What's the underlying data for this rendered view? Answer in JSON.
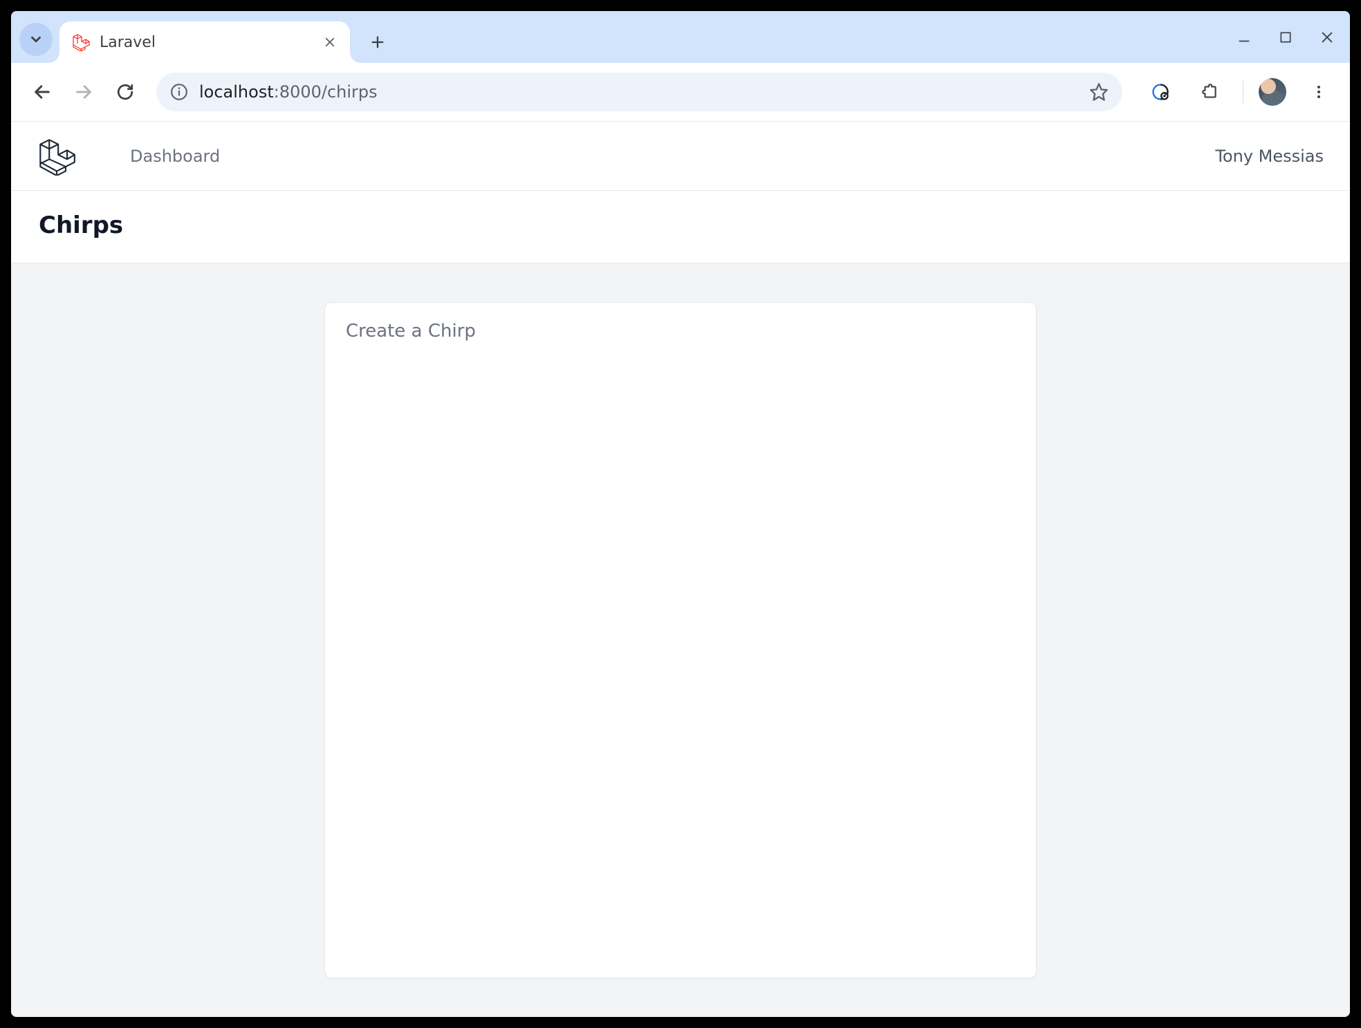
{
  "browser": {
    "tab_title": "Laravel",
    "url_host": "localhost",
    "url_port_path": ":8000/chirps"
  },
  "app": {
    "nav": {
      "dashboard_label": "Dashboard",
      "user_name": "Tony Messias"
    },
    "header": {
      "title": "Chirps"
    },
    "main": {
      "create_link": "Create a Chirp"
    }
  }
}
